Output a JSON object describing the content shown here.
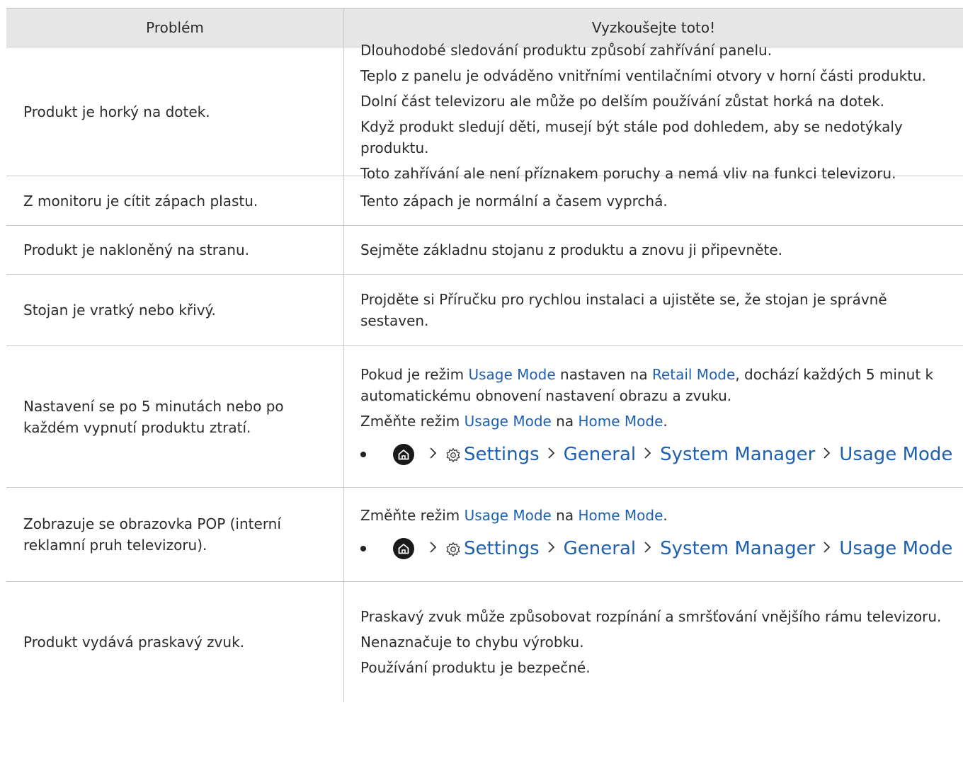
{
  "header": {
    "col_problem": "Problém",
    "col_solution": "Vyzkoušejte toto!"
  },
  "rows": [
    {
      "problem": "Produkt je horký na dotek.",
      "solutions": [
        "Dlouhodobé sledování produktu způsobí zahřívání panelu.",
        "Teplo z panelu je odváděno vnitřními ventilačními otvory v horní části produktu.",
        "Dolní část televizoru ale může po delším používání zůstat horká na dotek.",
        "Když produkt sledují děti, musejí být stále pod dohledem, aby se nedotýkaly produktu.",
        "Toto zahřívání ale není příznakem poruchy a nemá vliv na funkci televizoru."
      ]
    },
    {
      "problem": "Z monitoru je cítit zápach plastu.",
      "solutions": [
        "Tento zápach je normální a časem vyprchá."
      ]
    },
    {
      "problem": "Produkt je nakloněný na stranu.",
      "solutions": [
        "Sejměte základnu stojanu z produktu a znovu ji připevněte."
      ]
    },
    {
      "problem": "Stojan je vratký nebo křivý.",
      "solutions": [
        "Projděte si Příručku pro rychlou instalaci a ujistěte se, že stojan je správně sestaven."
      ]
    },
    {
      "problem": "Nastavení se po 5 minutách nebo po každém vypnutí produktu ztratí.",
      "line1": {
        "a": "Pokud je režim ",
        "b": "Usage Mode",
        "c": " nastaven na ",
        "d": "Retail Mode",
        "e": ", dochází každých 5 minut k automatickému obnovení nastavení obrazu a zvuku."
      },
      "line2": {
        "a": "Změňte režim ",
        "b": "Usage Mode",
        "c": " na ",
        "d": "Home Mode",
        "e": "."
      },
      "path": {
        "settings": "Settings",
        "general": "General",
        "system_manager": "System Manager",
        "usage_mode": "Usage Mode"
      }
    },
    {
      "problem": "Zobrazuje se obrazovka POP (interní reklamní pruh televizoru).",
      "line1": {
        "a": "Změňte režim ",
        "b": "Usage Mode",
        "c": " na ",
        "d": "Home Mode",
        "e": "."
      },
      "path": {
        "settings": "Settings",
        "general": "General",
        "system_manager": "System Manager",
        "usage_mode": "Usage Mode"
      }
    },
    {
      "problem": "Produkt vydává praskavý zvuk.",
      "solutions": [
        "Praskavý zvuk může způsobovat rozpínání a smršťování vnějšího rámu televizoru.",
        "Nenaznačuje to chybu výrobku.",
        "Používání produktu je bezpečné."
      ]
    }
  ],
  "icons": {
    "home": "home-icon",
    "gear": "gear-icon",
    "chevron": "chevron-right-icon",
    "bullet": "bullet"
  },
  "colors": {
    "link": "#1f5fb0",
    "header_bg": "#e6e6e6",
    "border": "#c8c8c8"
  }
}
